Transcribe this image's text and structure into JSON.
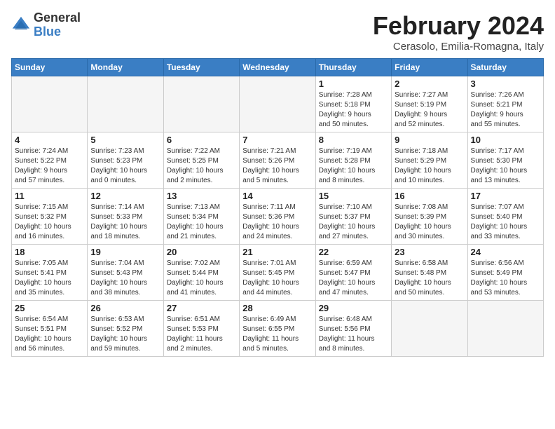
{
  "logo": {
    "general": "General",
    "blue": "Blue"
  },
  "header": {
    "month": "February 2024",
    "location": "Cerasolo, Emilia-Romagna, Italy"
  },
  "weekdays": [
    "Sunday",
    "Monday",
    "Tuesday",
    "Wednesday",
    "Thursday",
    "Friday",
    "Saturday"
  ],
  "weeks": [
    [
      {
        "day": "",
        "info": ""
      },
      {
        "day": "",
        "info": ""
      },
      {
        "day": "",
        "info": ""
      },
      {
        "day": "",
        "info": ""
      },
      {
        "day": "1",
        "info": "Sunrise: 7:28 AM\nSunset: 5:18 PM\nDaylight: 9 hours\nand 50 minutes."
      },
      {
        "day": "2",
        "info": "Sunrise: 7:27 AM\nSunset: 5:19 PM\nDaylight: 9 hours\nand 52 minutes."
      },
      {
        "day": "3",
        "info": "Sunrise: 7:26 AM\nSunset: 5:21 PM\nDaylight: 9 hours\nand 55 minutes."
      }
    ],
    [
      {
        "day": "4",
        "info": "Sunrise: 7:24 AM\nSunset: 5:22 PM\nDaylight: 9 hours\nand 57 minutes."
      },
      {
        "day": "5",
        "info": "Sunrise: 7:23 AM\nSunset: 5:23 PM\nDaylight: 10 hours\nand 0 minutes."
      },
      {
        "day": "6",
        "info": "Sunrise: 7:22 AM\nSunset: 5:25 PM\nDaylight: 10 hours\nand 2 minutes."
      },
      {
        "day": "7",
        "info": "Sunrise: 7:21 AM\nSunset: 5:26 PM\nDaylight: 10 hours\nand 5 minutes."
      },
      {
        "day": "8",
        "info": "Sunrise: 7:19 AM\nSunset: 5:28 PM\nDaylight: 10 hours\nand 8 minutes."
      },
      {
        "day": "9",
        "info": "Sunrise: 7:18 AM\nSunset: 5:29 PM\nDaylight: 10 hours\nand 10 minutes."
      },
      {
        "day": "10",
        "info": "Sunrise: 7:17 AM\nSunset: 5:30 PM\nDaylight: 10 hours\nand 13 minutes."
      }
    ],
    [
      {
        "day": "11",
        "info": "Sunrise: 7:15 AM\nSunset: 5:32 PM\nDaylight: 10 hours\nand 16 minutes."
      },
      {
        "day": "12",
        "info": "Sunrise: 7:14 AM\nSunset: 5:33 PM\nDaylight: 10 hours\nand 18 minutes."
      },
      {
        "day": "13",
        "info": "Sunrise: 7:13 AM\nSunset: 5:34 PM\nDaylight: 10 hours\nand 21 minutes."
      },
      {
        "day": "14",
        "info": "Sunrise: 7:11 AM\nSunset: 5:36 PM\nDaylight: 10 hours\nand 24 minutes."
      },
      {
        "day": "15",
        "info": "Sunrise: 7:10 AM\nSunset: 5:37 PM\nDaylight: 10 hours\nand 27 minutes."
      },
      {
        "day": "16",
        "info": "Sunrise: 7:08 AM\nSunset: 5:39 PM\nDaylight: 10 hours\nand 30 minutes."
      },
      {
        "day": "17",
        "info": "Sunrise: 7:07 AM\nSunset: 5:40 PM\nDaylight: 10 hours\nand 33 minutes."
      }
    ],
    [
      {
        "day": "18",
        "info": "Sunrise: 7:05 AM\nSunset: 5:41 PM\nDaylight: 10 hours\nand 35 minutes."
      },
      {
        "day": "19",
        "info": "Sunrise: 7:04 AM\nSunset: 5:43 PM\nDaylight: 10 hours\nand 38 minutes."
      },
      {
        "day": "20",
        "info": "Sunrise: 7:02 AM\nSunset: 5:44 PM\nDaylight: 10 hours\nand 41 minutes."
      },
      {
        "day": "21",
        "info": "Sunrise: 7:01 AM\nSunset: 5:45 PM\nDaylight: 10 hours\nand 44 minutes."
      },
      {
        "day": "22",
        "info": "Sunrise: 6:59 AM\nSunset: 5:47 PM\nDaylight: 10 hours\nand 47 minutes."
      },
      {
        "day": "23",
        "info": "Sunrise: 6:58 AM\nSunset: 5:48 PM\nDaylight: 10 hours\nand 50 minutes."
      },
      {
        "day": "24",
        "info": "Sunrise: 6:56 AM\nSunset: 5:49 PM\nDaylight: 10 hours\nand 53 minutes."
      }
    ],
    [
      {
        "day": "25",
        "info": "Sunrise: 6:54 AM\nSunset: 5:51 PM\nDaylight: 10 hours\nand 56 minutes."
      },
      {
        "day": "26",
        "info": "Sunrise: 6:53 AM\nSunset: 5:52 PM\nDaylight: 10 hours\nand 59 minutes."
      },
      {
        "day": "27",
        "info": "Sunrise: 6:51 AM\nSunset: 5:53 PM\nDaylight: 11 hours\nand 2 minutes."
      },
      {
        "day": "28",
        "info": "Sunrise: 6:49 AM\nSunset: 6:55 PM\nDaylight: 11 hours\nand 5 minutes."
      },
      {
        "day": "29",
        "info": "Sunrise: 6:48 AM\nSunset: 5:56 PM\nDaylight: 11 hours\nand 8 minutes."
      },
      {
        "day": "",
        "info": ""
      },
      {
        "day": "",
        "info": ""
      }
    ]
  ]
}
